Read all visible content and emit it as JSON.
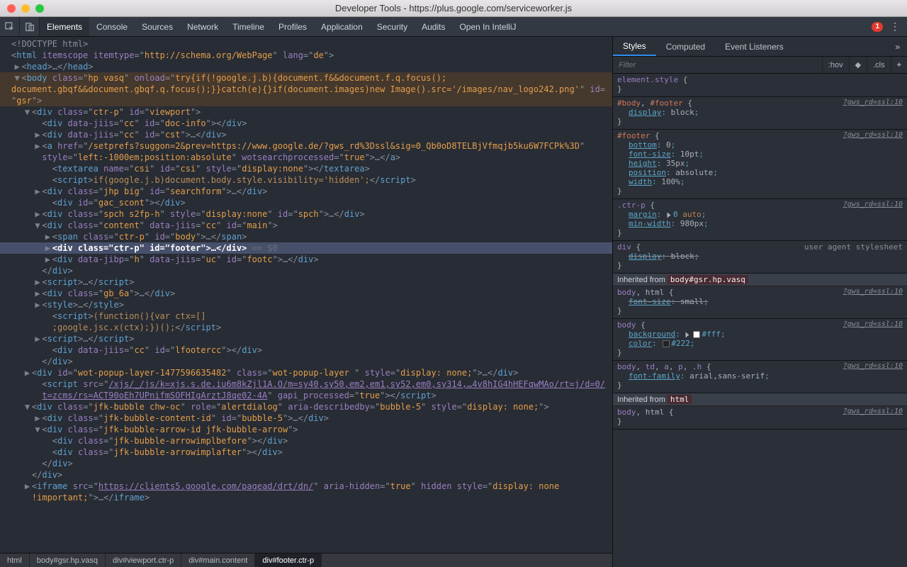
{
  "titlebar": {
    "title": "Developer Tools - https://plus.google.com/serviceworker.js"
  },
  "toolbar": {
    "tabs": [
      "Elements",
      "Console",
      "Sources",
      "Network",
      "Timeline",
      "Profiles",
      "Application",
      "Security",
      "Audits",
      "Open In IntelliJ"
    ],
    "active_tab": 0,
    "error_count": "1"
  },
  "dom": {
    "lines": [
      {
        "indent": 0,
        "arrow": "",
        "html": "<span class='doctype'>&lt;!DOCTYPE html&gt;</span>"
      },
      {
        "indent": 0,
        "arrow": "",
        "html": "<span class='p'>&lt;</span><span class='t'>html</span> <span class='a'>itemscope</span> <span class='a'>itemtype</span><span class='p'>=\"</span><span class='v'>http://schema.org/WebPage</span><span class='p'>\"</span> <span class='a'>lang</span><span class='p'>=\"</span><span class='v'>de</span><span class='p'>\"&gt;</span>"
      },
      {
        "indent": 1,
        "arrow": "▶",
        "html": "<span class='p'>&lt;</span><span class='t'>head</span><span class='p'>&gt;…&lt;/</span><span class='t'>head</span><span class='p'>&gt;</span>"
      },
      {
        "indent": 1,
        "arrow": "▼",
        "cls": "body-open",
        "html": "<span class='p'>&lt;</span><span class='t'>body</span> <span class='a'>class</span><span class='p'>=\"</span><span class='v'>hp vasq</span><span class='p'>\"</span> <span class='a'>onload</span><span class='p'>=\"</span><span class='v'>try{if(!google.j.b){document.f&amp;&amp;document.f.q.focus();</span>"
      },
      {
        "indent": 0,
        "arrow": "",
        "cls": "body-open",
        "html": "<span class='v'>document.gbqf&amp;&amp;document.gbqf.q.focus();}}catch(e){}if(document.images)new Image().src='/images/nav_logo242.png'</span><span class='p'>\"</span> <span class='a'>id</span><span class='p'>=</span>"
      },
      {
        "indent": 0,
        "arrow": "",
        "cls": "body-open",
        "html": "<span class='p'>\"</span><span class='v'>gsr</span><span class='p'>\"&gt;</span>"
      },
      {
        "indent": 2,
        "arrow": "▼",
        "html": "<span class='p'>&lt;</span><span class='t'>div</span> <span class='a'>class</span><span class='p'>=\"</span><span class='v'>ctr-p</span><span class='p'>\"</span> <span class='a'>id</span><span class='p'>=\"</span><span class='v'>viewport</span><span class='p'>\"&gt;</span>"
      },
      {
        "indent": 3,
        "arrow": "",
        "html": "<span class='p'>&lt;</span><span class='t'>div</span> <span class='a'>data-jiis</span><span class='p'>=\"</span><span class='v'>cc</span><span class='p'>\"</span> <span class='a'>id</span><span class='p'>=\"</span><span class='v'>doc-info</span><span class='p'>\"&gt;&lt;/</span><span class='t'>div</span><span class='p'>&gt;</span>"
      },
      {
        "indent": 3,
        "arrow": "▶",
        "html": "<span class='p'>&lt;</span><span class='t'>div</span> <span class='a'>data-jiis</span><span class='p'>=\"</span><span class='v'>cc</span><span class='p'>\"</span> <span class='a'>id</span><span class='p'>=\"</span><span class='v'>cst</span><span class='p'>\"&gt;…&lt;/</span><span class='t'>div</span><span class='p'>&gt;</span>"
      },
      {
        "indent": 3,
        "arrow": "▶",
        "html": "<span class='p'>&lt;</span><span class='t'>a</span> <span class='a'>href</span><span class='p'>=\"</span><span class='v'>/setprefs?suggon=2&amp;prev=https://www.google.de/?gws_rd%3Dssl&amp;sig=0_Qb0oD8TELBjVfmqjb5ku6W7FCPk%3D</span><span class='p'>\"</span>"
      },
      {
        "indent": 3,
        "arrow": "",
        "html": "<span class='a'>style</span><span class='p'>=\"</span><span class='v'>left:-1000em;position:absolute</span><span class='p'>\"</span> <span class='a'>wotsearchprocessed</span><span class='p'>=\"</span><span class='v'>true</span><span class='p'>\"&gt;…&lt;/</span><span class='t'>a</span><span class='p'>&gt;</span>"
      },
      {
        "indent": 4,
        "arrow": "",
        "html": "<span class='p'>&lt;</span><span class='t'>textarea</span> <span class='a'>name</span><span class='p'>=\"</span><span class='v'>csi</span><span class='p'>\"</span> <span class='a'>id</span><span class='p'>=\"</span><span class='v'>csi</span><span class='p'>\"</span> <span class='a'>style</span><span class='p'>=\"</span><span class='v'>display:none</span><span class='p'>\"&gt;&lt;/</span><span class='t'>textarea</span><span class='p'>&gt;</span>"
      },
      {
        "indent": 4,
        "arrow": "",
        "html": "<span class='p'>&lt;</span><span class='t'>script</span><span class='p'>&gt;</span><span class='s'>if(google.j.b)document.body.style.visibility='hidden';</span><span class='p'>&lt;/</span><span class='t'>script</span><span class='p'>&gt;</span>"
      },
      {
        "indent": 3,
        "arrow": "▶",
        "html": "<span class='p'>&lt;</span><span class='t'>div</span> <span class='a'>class</span><span class='p'>=\"</span><span class='v'>jhp big</span><span class='p'>\"</span> <span class='a'>id</span><span class='p'>=\"</span><span class='v'>searchform</span><span class='p'>\"&gt;…&lt;/</span><span class='t'>div</span><span class='p'>&gt;</span>"
      },
      {
        "indent": 4,
        "arrow": "",
        "html": "<span class='p'>&lt;</span><span class='t'>div</span> <span class='a'>id</span><span class='p'>=\"</span><span class='v'>gac_scont</span><span class='p'>\"&gt;&lt;/</span><span class='t'>div</span><span class='p'>&gt;</span>"
      },
      {
        "indent": 3,
        "arrow": "▶",
        "html": "<span class='p'>&lt;</span><span class='t'>div</span> <span class='a'>class</span><span class='p'>=\"</span><span class='v'>spch s2fp-h</span><span class='p'>\"</span> <span class='a'>style</span><span class='p'>=\"</span><span class='v'>display:none</span><span class='p'>\"</span> <span class='a'>id</span><span class='p'>=\"</span><span class='v'>spch</span><span class='p'>\"&gt;…&lt;/</span><span class='t'>div</span><span class='p'>&gt;</span>"
      },
      {
        "indent": 3,
        "arrow": "▼",
        "html": "<span class='p'>&lt;</span><span class='t'>div</span> <span class='a'>class</span><span class='p'>=\"</span><span class='v'>content</span><span class='p'>\"</span> <span class='a'>data-jiis</span><span class='p'>=\"</span><span class='v'>cc</span><span class='p'>\"</span> <span class='a'>id</span><span class='p'>=\"</span><span class='v'>main</span><span class='p'>\"&gt;</span>"
      },
      {
        "indent": 4,
        "arrow": "▶",
        "html": "<span class='p'>&lt;</span><span class='t'>span</span> <span class='a'>class</span><span class='p'>=\"</span><span class='v'>ctr-p</span><span class='p'>\"</span> <span class='a'>id</span><span class='p'>=\"</span><span class='v'>body</span><span class='p'>\"&gt;…&lt;/</span><span class='t'>span</span><span class='p'>&gt;</span>"
      },
      {
        "indent": 4,
        "arrow": "▶",
        "cls": "sel-strong",
        "html": "<b>&lt;div class=\"ctr-p\" id=\"footer\"&gt;…&lt;/div&gt;</b> <span class='hint'>== $0</span>"
      },
      {
        "indent": 4,
        "arrow": "▶",
        "html": "<span class='p'>&lt;</span><span class='t'>div</span> <span class='a'>data-jibp</span><span class='p'>=\"</span><span class='v'>h</span><span class='p'>\"</span> <span class='a'>data-jiis</span><span class='p'>=\"</span><span class='v'>uc</span><span class='p'>\"</span> <span class='a'>id</span><span class='p'>=\"</span><span class='v'>footc</span><span class='p'>\"&gt;…&lt;/</span><span class='t'>div</span><span class='p'>&gt;</span>"
      },
      {
        "indent": 3,
        "arrow": "",
        "html": "<span class='p'>&lt;/</span><span class='t'>div</span><span class='p'>&gt;</span>"
      },
      {
        "indent": 3,
        "arrow": "▶",
        "html": "<span class='p'>&lt;</span><span class='t'>script</span><span class='p'>&gt;…&lt;/</span><span class='t'>script</span><span class='p'>&gt;</span>"
      },
      {
        "indent": 3,
        "arrow": "▶",
        "html": "<span class='p'>&lt;</span><span class='t'>div</span> <span class='a'>class</span><span class='p'>=\"</span><span class='v'>gb_6a</span><span class='p'>\"&gt;…&lt;/</span><span class='t'>div</span><span class='p'>&gt;</span>"
      },
      {
        "indent": 3,
        "arrow": "▶",
        "html": "<span class='p'>&lt;</span><span class='t'>style</span><span class='p'>&gt;…&lt;/</span><span class='t'>style</span><span class='p'>&gt;</span>"
      },
      {
        "indent": 4,
        "arrow": "",
        "html": "<span class='p'>&lt;</span><span class='t'>script</span><span class='p'>&gt;</span><span class='s'>(function(){var ctx=[]</span>"
      },
      {
        "indent": 4,
        "arrow": "",
        "html": "<span class='s'>;google.jsc.x(ctx);})();</span><span class='p'>&lt;/</span><span class='t'>script</span><span class='p'>&gt;</span>"
      },
      {
        "indent": 3,
        "arrow": "▶",
        "html": "<span class='p'>&lt;</span><span class='t'>script</span><span class='p'>&gt;…&lt;/</span><span class='t'>script</span><span class='p'>&gt;</span>"
      },
      {
        "indent": 4,
        "arrow": "",
        "html": "<span class='p'>&lt;</span><span class='t'>div</span> <span class='a'>data-jiis</span><span class='p'>=\"</span><span class='v'>cc</span><span class='p'>\"</span> <span class='a'>id</span><span class='p'>=\"</span><span class='v'>lfootercc</span><span class='p'>\"&gt;&lt;/</span><span class='t'>div</span><span class='p'>&gt;</span>"
      },
      {
        "indent": 3,
        "arrow": "",
        "html": "<span class='p'>&lt;/</span><span class='t'>div</span><span class='p'>&gt;</span>"
      },
      {
        "indent": 2,
        "arrow": "▶",
        "html": "<span class='p'>&lt;</span><span class='t'>div</span> <span class='a'>id</span><span class='p'>=\"</span><span class='v'>wot-popup-layer-1477596635482</span><span class='p'>\"</span> <span class='a'>class</span><span class='p'>=\"</span><span class='v'>wot-popup-layer </span><span class='p'>\"</span> <span class='a'>style</span><span class='p'>=\"</span><span class='v'>display: none;</span><span class='p'>\"&gt;…&lt;/</span><span class='t'>div</span><span class='p'>&gt;</span>"
      },
      {
        "indent": 3,
        "arrow": "",
        "html": "<span class='p'>&lt;</span><span class='t'>script</span> <span class='a'>src</span><span class='p'>=\"</span><span class='v url'>/xjs/_/js/k=xjs.s.de.iu6m8kZjl1A.O/m=sy40,sy50,em2,em1,sy52,em0,sy314,…4v8hIG4hHEFqwMAo/rt=j/d=0/</span>"
      },
      {
        "indent": 3,
        "arrow": "",
        "html": "<span class='v url'>t=zcms/rs=ACT90oEh7UPnifmSOFHIgArztJ8qe02-4A</span><span class='p'>\"</span> <span class='a'>gapi_processed</span><span class='p'>=\"</span><span class='v'>true</span><span class='p'>\"&gt;&lt;/</span><span class='t'>script</span><span class='p'>&gt;</span>"
      },
      {
        "indent": 2,
        "arrow": "▼",
        "html": "<span class='p'>&lt;</span><span class='t'>div</span> <span class='a'>class</span><span class='p'>=\"</span><span class='v'>jfk-bubble chw-oc</span><span class='p'>\"</span> <span class='a'>role</span><span class='p'>=\"</span><span class='v'>alertdialog</span><span class='p'>\"</span> <span class='a'>aria-describedby</span><span class='p'>=\"</span><span class='v'>bubble-5</span><span class='p'>\"</span> <span class='a'>style</span><span class='p'>=\"</span><span class='v'>display: none;</span><span class='p'>\"&gt;</span>"
      },
      {
        "indent": 3,
        "arrow": "▶",
        "html": "<span class='p'>&lt;</span><span class='t'>div</span> <span class='a'>class</span><span class='p'>=\"</span><span class='v'>jfk-bubble-content-id</span><span class='p'>\"</span> <span class='a'>id</span><span class='p'>=\"</span><span class='v'>bubble-5</span><span class='p'>\"&gt;…&lt;/</span><span class='t'>div</span><span class='p'>&gt;</span>"
      },
      {
        "indent": 3,
        "arrow": "▼",
        "html": "<span class='p'>&lt;</span><span class='t'>div</span> <span class='a'>class</span><span class='p'>=\"</span><span class='v'>jfk-bubble-arrow-id jfk-bubble-arrow</span><span class='p'>\"&gt;</span>"
      },
      {
        "indent": 4,
        "arrow": "",
        "html": "<span class='p'>&lt;</span><span class='t'>div</span> <span class='a'>class</span><span class='p'>=\"</span><span class='v'>jfk-bubble-arrowimplbefore</span><span class='p'>\"&gt;&lt;/</span><span class='t'>div</span><span class='p'>&gt;</span>"
      },
      {
        "indent": 4,
        "arrow": "",
        "html": "<span class='p'>&lt;</span><span class='t'>div</span> <span class='a'>class</span><span class='p'>=\"</span><span class='v'>jfk-bubble-arrowimplafter</span><span class='p'>\"&gt;&lt;/</span><span class='t'>div</span><span class='p'>&gt;</span>"
      },
      {
        "indent": 3,
        "arrow": "",
        "html": "<span class='p'>&lt;/</span><span class='t'>div</span><span class='p'>&gt;</span>"
      },
      {
        "indent": 2,
        "arrow": "",
        "html": "<span class='p'>&lt;/</span><span class='t'>div</span><span class='p'>&gt;</span>"
      },
      {
        "indent": 2,
        "arrow": "▶",
        "html": "<span class='p'>&lt;</span><span class='t'>iframe</span> <span class='a'>src</span><span class='p'>=\"</span><span class='v url'>https://clients5.google.com/pagead/drt/dn/</span><span class='p'>\"</span> <span class='a'>aria-hidden</span><span class='p'>=\"</span><span class='v'>true</span><span class='p'>\"</span> <span class='a'>hidden</span> <span class='a'>style</span><span class='p'>=\"</span><span class='v'>display: none</span>"
      },
      {
        "indent": 2,
        "arrow": "",
        "html": "<span class='v'>!important;</span><span class='p'>\"&gt;…&lt;/</span><span class='t'>iframe</span><span class='p'>&gt;</span>"
      }
    ]
  },
  "breadcrumbs": [
    "html",
    "body#gsr.hp.vasq",
    "div#viewport.ctr-p",
    "div#main.content",
    "div#footer.ctr-p"
  ],
  "side": {
    "tabs": [
      "Styles",
      "Computed",
      "Event Listeners"
    ],
    "filter_placeholder": "Filter",
    "hov": ":hov",
    "cls": ".cls",
    "rules": [
      {
        "sel": "element.style",
        "props": [],
        "link": ""
      },
      {
        "sel_html": "<span class='sel-id'>#body</span><span class='sel-rest'>, </span><span class='sel-id'>#footer</span>",
        "link": "?gws_rd=ssl:10",
        "props": [
          {
            "n": "display",
            "v": "block"
          }
        ]
      },
      {
        "sel_html": "<span class='sel-id'>#footer</span>",
        "link": "?gws_rd=ssl:10",
        "props": [
          {
            "n": "bottom",
            "v": "0"
          },
          {
            "n": "font-size",
            "v": "10pt"
          },
          {
            "n": "height",
            "v": "35px"
          },
          {
            "n": "position",
            "v": "absolute"
          },
          {
            "n": "width",
            "v": "100%"
          }
        ]
      },
      {
        "sel_html": "<span class='sel-css'>.ctr-p</span>",
        "link": "?gws_rd=ssl:10",
        "props": [
          {
            "n": "margin",
            "v_html": "<span class='tri'></span>0 <span class='kw'>auto</span>"
          },
          {
            "n": "min-width",
            "v": "980px"
          }
        ]
      },
      {
        "sel_html": "<span class='sel-css'>div</span>",
        "ua": "user agent stylesheet",
        "props": [
          {
            "n": "display",
            "v": "block",
            "strike": true
          }
        ]
      },
      {
        "inherited": "Inherited from ",
        "chip": "body#gsr.hp.vasq"
      },
      {
        "sel_html": "<span class='sel-css'>body</span><span class='sel-rest'>, html</span>",
        "link": "?gws_rd=ssl:10",
        "props": [
          {
            "n": "font-size",
            "v": "small",
            "strike": true
          }
        ]
      },
      {
        "sel_html": "<span class='sel-css'>body</span>",
        "link": "?gws_rd=ssl:10",
        "props": [
          {
            "n": "background",
            "v_html": "<span class='tri'></span><span class='swatch' style='background:#fff'></span>#fff",
            "strike": false,
            "grey": true
          },
          {
            "n": "color",
            "v_html": "<span class='swatch' style='background:#222'></span>#222"
          }
        ]
      },
      {
        "sel_html": "<span class='sel-css'>body</span><span class='sel-rest'>, </span><span class='sel-css'>td</span><span class='sel-rest'>, </span><span class='sel-css'>a</span><span class='sel-rest'>, </span><span class='sel-css'>p</span><span class='sel-rest'>, </span><span class='sel-css'>.h</span>",
        "link": "?gws_rd=ssl:10",
        "props": [
          {
            "n": "font-family",
            "v": "arial,sans-serif"
          }
        ]
      },
      {
        "inherited": "Inherited from ",
        "chip": "html"
      },
      {
        "sel_html": "<span class='sel-css'>body</span><span class='sel-rest'>, html</span>",
        "link": "?gws_rd=ssl:10",
        "props": []
      }
    ]
  }
}
